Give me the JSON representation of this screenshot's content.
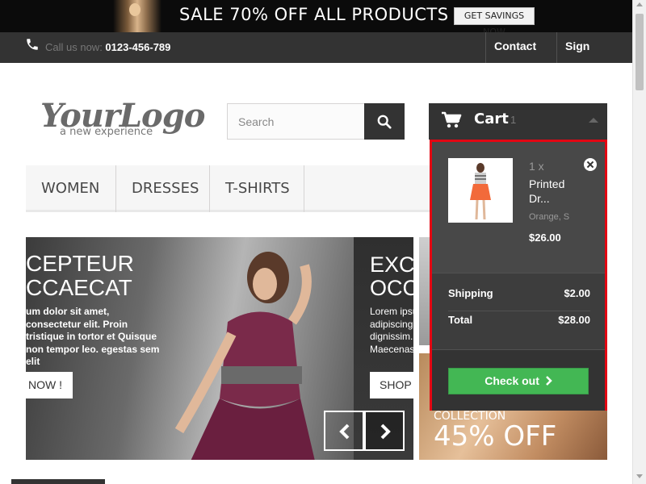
{
  "banner": {
    "text": "SALE 70% OFF ALL PRODUCTS",
    "button": "GET SAVINGS NOW"
  },
  "topnav": {
    "call_prefix": "Call us now: ",
    "phone": "0123-456-789",
    "contact": "Contact us",
    "signin": "Sign in"
  },
  "logo": {
    "main": "YourLogo",
    "tagline": "a new experience"
  },
  "search": {
    "placeholder": "Search"
  },
  "cart": {
    "label": "Cart",
    "count": "1",
    "item": {
      "qty": "1 x",
      "name": "Printed\nDr...",
      "attributes": "Orange, S",
      "price": "$26.00"
    },
    "shipping_label": "Shipping",
    "shipping_value": "$2.00",
    "total_label": "Total",
    "total_value": "$28.00",
    "checkout": "Check out"
  },
  "menu": [
    "WOMEN",
    "DRESSES",
    "T-SHIRTS"
  ],
  "slider": {
    "slide1_title": "CEPTEUR\nCCAECAT",
    "slide1_text": "um dolor sit amet, consectetur elit. Proin tristique in tortor et Quisque non tempor leo. egestas sem elit",
    "slide1_button": "NOW !",
    "slide2_title": "EXC\nOCC",
    "slide2_text": "Lorem ipsu\nadipiscing\ndignissim.\nMaecenas",
    "slide2_button": "SHOP"
  },
  "side_banner": {
    "sub": "COLLECTION",
    "big": "45% OFF"
  },
  "colors": {
    "dark": "#333333",
    "checkout_green": "#43b754",
    "highlight_red": "#e30613"
  }
}
